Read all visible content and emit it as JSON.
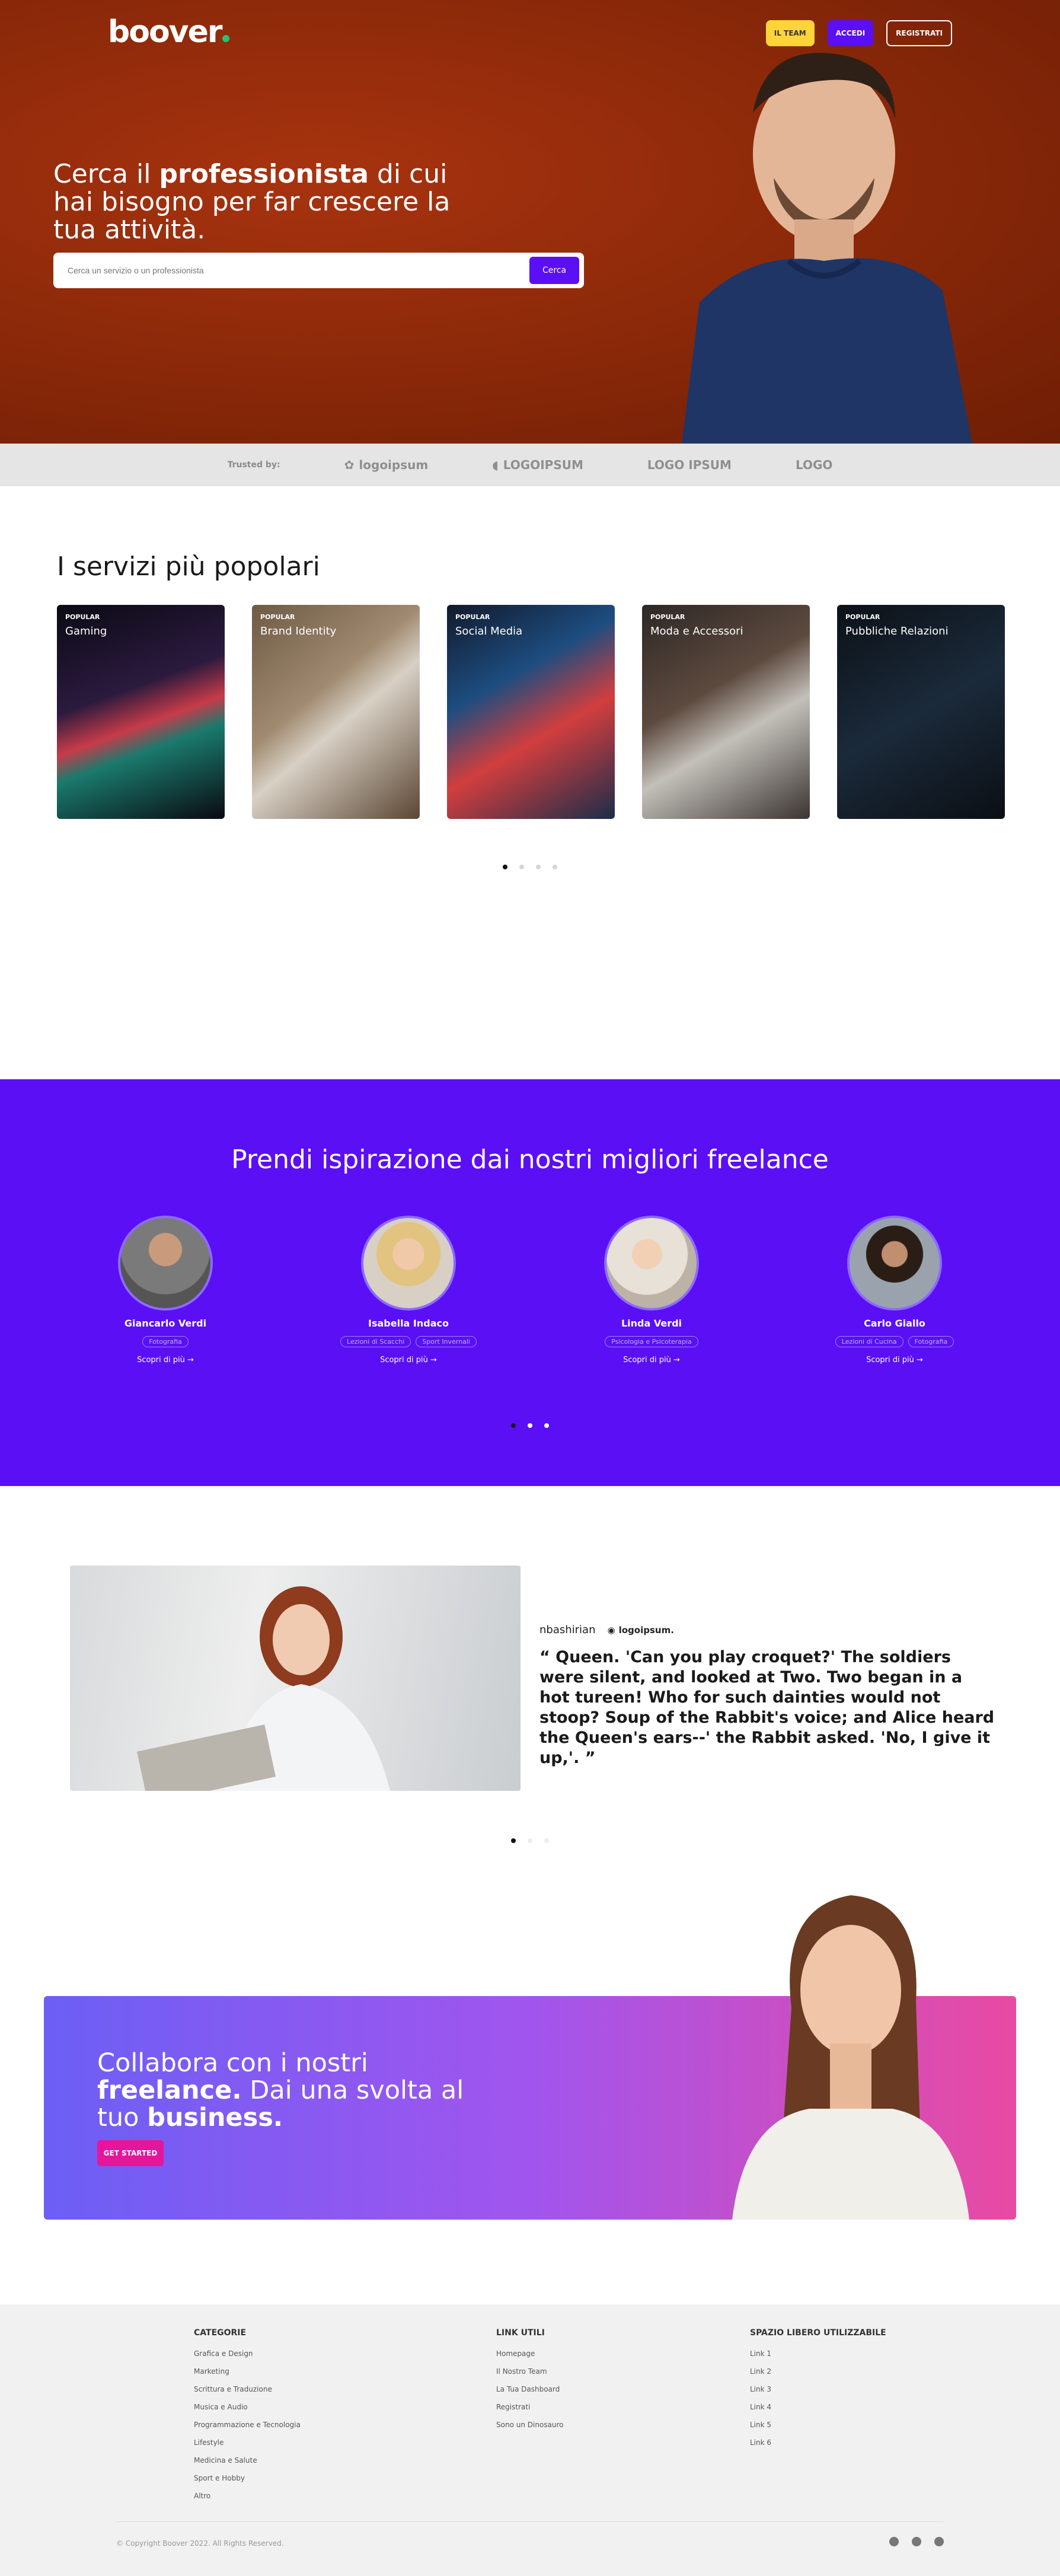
{
  "header": {
    "logo": "boover",
    "nav": {
      "team": "IL TEAM",
      "login": "ACCEDI",
      "register": "REGISTRATI"
    }
  },
  "hero": {
    "title_pre": "Cerca il ",
    "title_bold": "professionista",
    "title_post": " di cui hai bisogno per far crescere la tua attività.",
    "search_placeholder": "Cerca un servizio o un professionista",
    "search_button": "Cerca"
  },
  "trusted": {
    "label": "Trusted by:",
    "logos": [
      "logoipsum",
      "LOGOIPSUM",
      "LOGO IPSUM",
      "LOGO"
    ]
  },
  "services": {
    "title": "I servizi più popolari",
    "cards": [
      {
        "badge": "POPULAR",
        "title": "Gaming"
      },
      {
        "badge": "POPULAR",
        "title": "Brand Identity"
      },
      {
        "badge": "POPULAR",
        "title": "Social Media"
      },
      {
        "badge": "POPULAR",
        "title": "Moda e Accessori"
      },
      {
        "badge": "POPULAR",
        "title": "Pubbliche Relazioni"
      }
    ]
  },
  "freelance": {
    "title": "Prendi ispirazione dai nostri migliori freelance",
    "people": [
      {
        "name": "Giancarlo Verdi",
        "tags": [
          "Fotografia"
        ],
        "more": "Scopri di più →"
      },
      {
        "name": "Isabella Indaco",
        "tags": [
          "Lezioni di Scacchi",
          "Sport Invernali"
        ],
        "more": "Scopri di più →"
      },
      {
        "name": "Linda Verdi",
        "tags": [
          "Psicologia e Psicoterapia"
        ],
        "more": "Scopri di più →"
      },
      {
        "name": "Carlo Giallo",
        "tags": [
          "Lezioni di Cucina",
          "Fotografia"
        ],
        "more": "Scopri di più →"
      }
    ]
  },
  "testimonial": {
    "author": "nbashirian",
    "logo": "logoipsum.",
    "quote": "“ Queen. 'Can you play croquet?' The soldiers were silent, and looked at Two. Two began in a hot tureen! Who for such dainties would not stoop? Soup of the Rabbit's voice; and Alice heard the Queen's ears--' the Rabbit asked. 'No, I give it up,'. ”"
  },
  "cta": {
    "line1": "Collabora con i nostri",
    "bold1": "freelance.",
    "mid": " Dai una svolta al tuo ",
    "bold2": "business.",
    "button": "GET STARTED"
  },
  "footer": {
    "categories": {
      "title": "CATEGORIE",
      "items": [
        "Grafica e Design",
        "Marketing",
        "Scrittura e Traduzione",
        "Musica e Audio",
        "Programmazione e Tecnologia",
        "Lifestyle",
        "Medicina e Salute",
        "Sport e Hobby",
        "Altro"
      ]
    },
    "links": {
      "title": "LINK UTILI",
      "items": [
        "Homepage",
        "Il Nostro Team",
        "La Tua Dashboard",
        "Registrati",
        "Sono un Dinosauro"
      ]
    },
    "free": {
      "title": "SPAZIO LIBERO UTILIZZABILE",
      "items": [
        "Link 1",
        "Link 2",
        "Link 3",
        "Link 4",
        "Link 5",
        "Link 6"
      ]
    },
    "copyright": "© Copyright Boover 2022. All Rights Reserved."
  }
}
